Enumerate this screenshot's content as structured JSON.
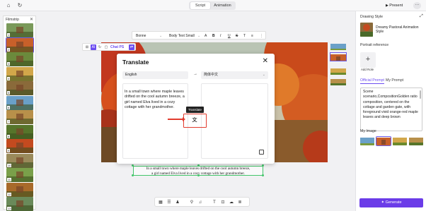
{
  "header": {
    "tabs": [
      {
        "label": "Script",
        "active": true
      },
      {
        "label": "Animation",
        "active": false
      }
    ],
    "present_label": "Present",
    "more_label": "···"
  },
  "filmstrip": {
    "title": "Filmstrip",
    "close_icon": "close-icon",
    "frames": [
      "1",
      "2",
      "3",
      "4",
      "5",
      "6",
      "7",
      "8",
      "9",
      "10",
      "11",
      "12",
      "13"
    ],
    "selected_index": 1
  },
  "format_bar": {
    "font": "Bonne",
    "style": "Body Text Small",
    "tools": [
      "A",
      "B",
      "I",
      "U",
      "S",
      "T",
      "≡",
      "⋮"
    ]
  },
  "image_toolbar": {
    "ai_label": "AI",
    "chatps_label": "Chat PS"
  },
  "caption": {
    "line1": "In a small town where maple leaves drifted on the cool autumn breeze,",
    "line2": "a girl named Elva lived in a cozy cottage with her grandmother."
  },
  "translate_dialog": {
    "title": "Translate",
    "source_lang": "English",
    "target_lang": "简体中文",
    "arrow": "→",
    "source_text": "In a small town where maple leaves drifted on the cool autumn breeze, a girl named Elva lived in a cozy cottage with her grandmother.",
    "tooltip": "Translate",
    "close_label": "✕"
  },
  "right_panel": {
    "drawing_style_label": "Drawing Style",
    "style_name": "Dreamy Pastoral Animation Style",
    "portrait_reference_label": "Portrait reference",
    "add_ref_label": "Add Role",
    "tabs": [
      {
        "label": "Official Prompt",
        "active": true
      },
      {
        "label": "My Prompt",
        "active": false
      }
    ],
    "prompt_text": "Scene scenario,CompositionGolden ratio composition, centered on the cottage and garden gate, with foreground vivid orange-red maple leaves and deep brown",
    "my_image_label": "My Image",
    "generate_label": "Generate"
  },
  "colors": {
    "accent": "#6c4df0",
    "generate": "#6b3ce8",
    "highlight": "#e23b2e",
    "selection": "#43c56a"
  }
}
